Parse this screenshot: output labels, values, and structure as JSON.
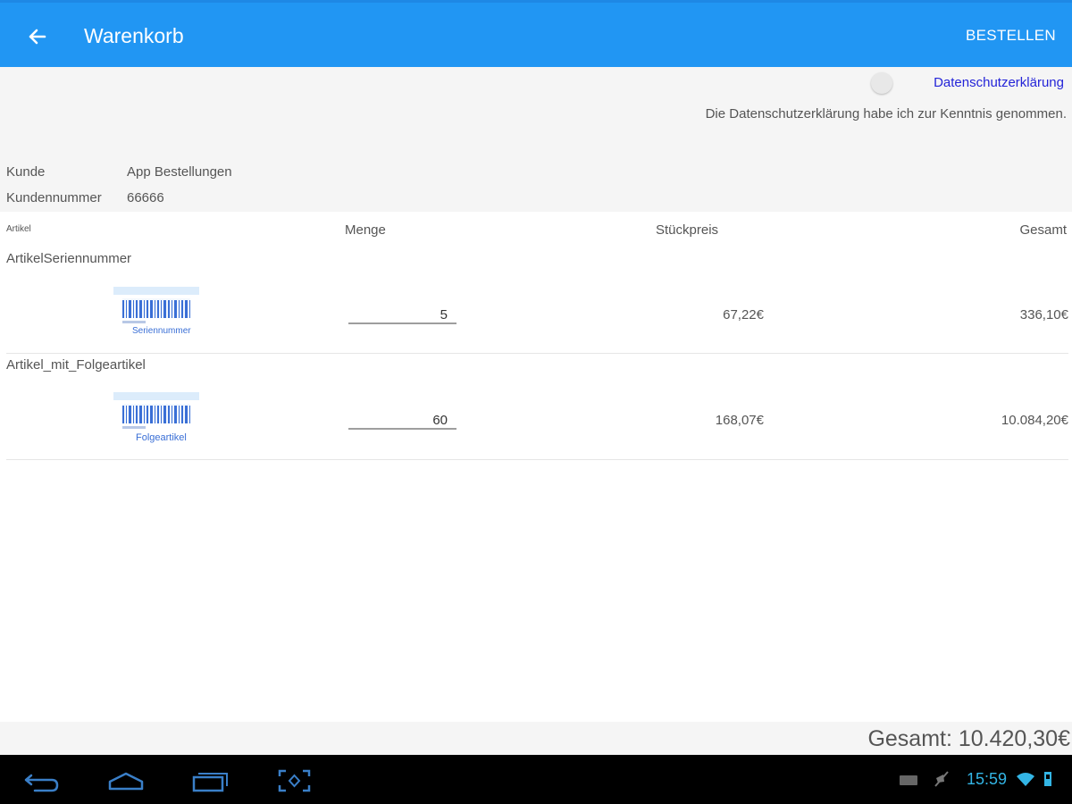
{
  "header": {
    "title": "Warenkorb",
    "order_label": "BESTELLEN",
    "back_icon": "arrow-left-icon"
  },
  "privacy": {
    "link_label": "Datenschutzerklärung",
    "note": "Die Datenschutzerklärung habe ich zur Kenntnis genommen.",
    "accepted": false
  },
  "customer": {
    "name_label": "Kunde",
    "name_value": "App Bestellungen",
    "number_label": "Kundennummer",
    "number_value": "66666"
  },
  "table": {
    "headers": {
      "article": "Artikel",
      "quantity": "Menge",
      "unit_price": "Stückpreis",
      "total": "Gesamt"
    },
    "rows": [
      {
        "name": "ArtikelSeriennummer",
        "image_caption": "Seriennummer",
        "quantity": "5",
        "unit_price": "67,22€",
        "total": "336,10€"
      },
      {
        "name": "Artikel_mit_Folgeartikel",
        "image_caption": "Folgeartikel",
        "quantity": "60",
        "unit_price": "168,07€",
        "total": "10.084,20€"
      }
    ]
  },
  "footer": {
    "grand_total": "Gesamt: 10.420,30€"
  },
  "system_bar": {
    "time": "15:59",
    "nav_icons": [
      "back-icon",
      "home-icon",
      "recent-apps-icon",
      "screenshot-icon"
    ],
    "status_icons": [
      "keyboard-icon",
      "mute-icon",
      "wifi-icon",
      "signal-icon"
    ]
  },
  "colors": {
    "primary": "#2196f3",
    "link": "#2424d8",
    "clock": "#33b5e5",
    "barcode": "#3a6fd6"
  }
}
